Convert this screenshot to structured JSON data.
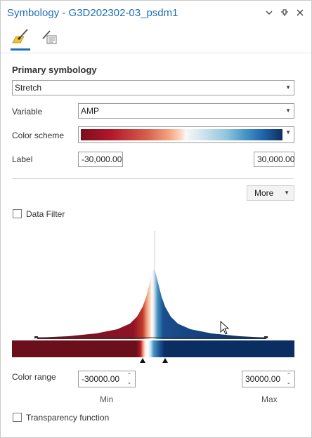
{
  "window": {
    "title": "Symbology - G3D202302-03_psdm1",
    "icons": [
      "chevron-down-icon",
      "pin-icon",
      "close-icon"
    ]
  },
  "tabs": [
    {
      "name": "primary-symbology-tab",
      "icon": "paintbrush-icon",
      "active": true
    },
    {
      "name": "secondary-symbology-tab",
      "icon": "list-edit-icon",
      "active": false
    }
  ],
  "primary": {
    "heading": "Primary symbology",
    "renderer": "Stretch",
    "variable_label": "Variable",
    "variable_value": "AMP",
    "color_scheme_label": "Color scheme",
    "label_label": "Label",
    "label_min": "-30,000.00",
    "label_max": "30,000.00"
  },
  "more_button": "More",
  "data_filter": {
    "label": "Data Filter",
    "checked": false
  },
  "color_range": {
    "label": "Color range",
    "min_value": "-30000.00",
    "max_value": "30000.00",
    "min_caption": "Min",
    "max_caption": "Max"
  },
  "transparency": {
    "label": "Transparency function",
    "checked": false
  },
  "colors": {
    "accent": "#1f6fb5",
    "ramp_low": "#7a0f1c",
    "ramp_mid": "#f7f7f7",
    "ramp_high": "#0d2f5e"
  }
}
